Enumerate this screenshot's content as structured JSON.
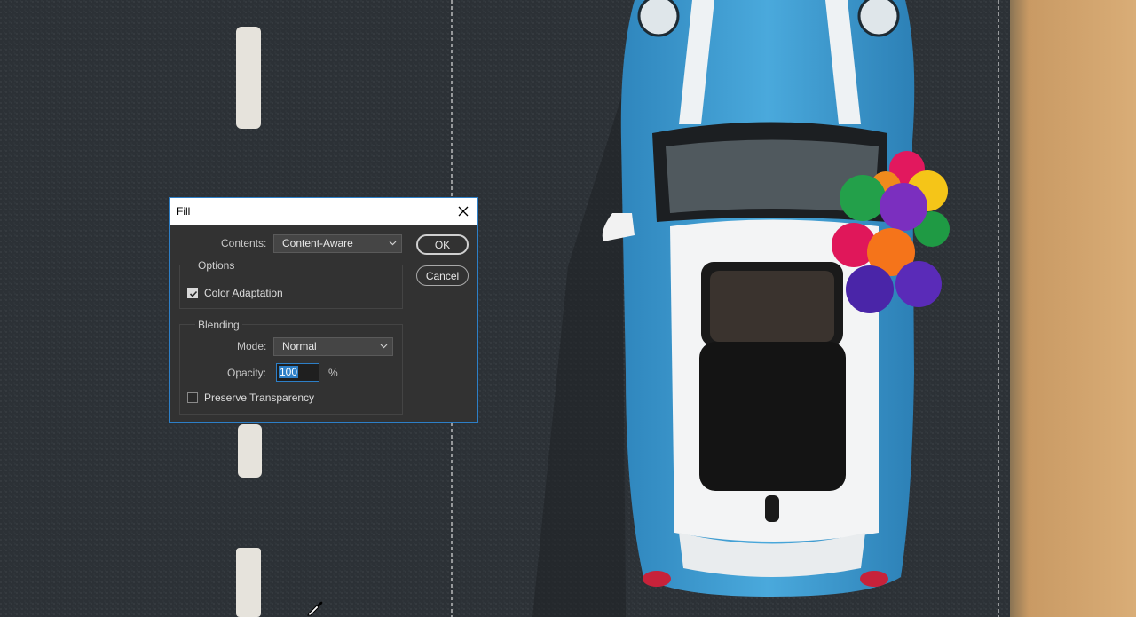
{
  "dialog": {
    "title": "Fill",
    "contents_label": "Contents:",
    "contents_value": "Content-Aware",
    "options_legend": "Options",
    "color_adaptation_label": "Color Adaptation",
    "color_adaptation_checked": true,
    "blending_legend": "Blending",
    "mode_label": "Mode:",
    "mode_value": "Normal",
    "opacity_label": "Opacity:",
    "opacity_value": "100",
    "opacity_unit": "%",
    "preserve_transparency_label": "Preserve Transparency",
    "preserve_transparency_checked": false,
    "ok_label": "OK",
    "cancel_label": "Cancel"
  },
  "icons": {
    "close": "close-icon",
    "dropdown": "chevron-down-icon",
    "check": "checkmark-icon",
    "cursor": "eyedropper-icon"
  },
  "colors": {
    "accent": "#2d7fc7",
    "dialog_bg": "#323232",
    "asphalt": "#2c3136",
    "car_blue": "#3a9ad1",
    "sand": "#d2a46c"
  }
}
